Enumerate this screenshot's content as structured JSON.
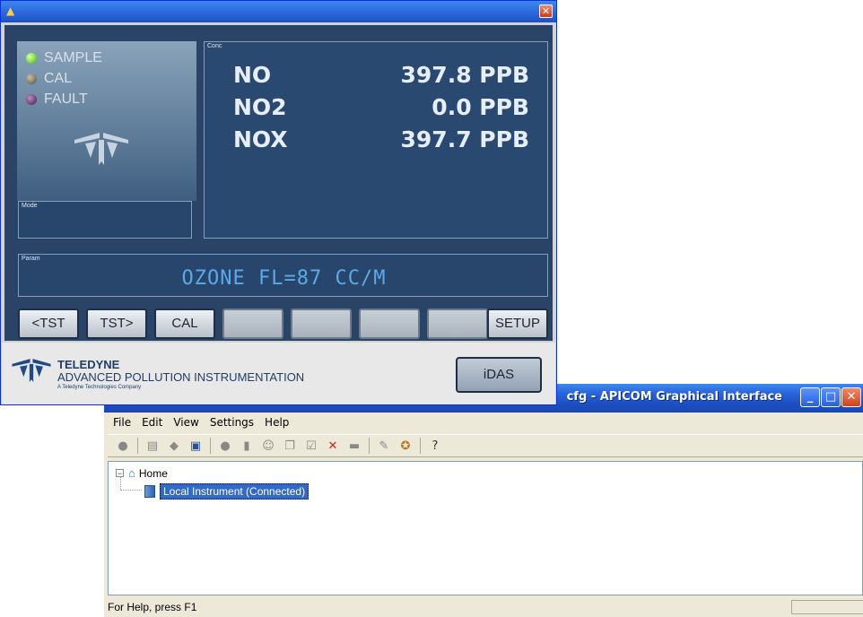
{
  "apicom": {
    "title": "cfg - APICOM Graphical Interface",
    "menu": [
      {
        "label": "File"
      },
      {
        "label": "Edit"
      },
      {
        "label": "View"
      },
      {
        "label": "Settings"
      },
      {
        "label": "Help"
      }
    ],
    "tree": {
      "root_label": "Home",
      "child_label": "Local Instrument (Connected)"
    },
    "status_text": "For Help, press F1"
  },
  "front": {
    "leds": [
      {
        "label": "SAMPLE",
        "color": "#7fe04a"
      },
      {
        "label": "CAL",
        "color": "#8a8270"
      },
      {
        "label": "FAULT",
        "color": "#7a4a7a"
      }
    ],
    "mode_label": "Mode",
    "conc_label": "Conc",
    "concentrations": [
      {
        "name": "NO",
        "value": "397.8 PPB"
      },
      {
        "name": "NO2",
        "value": "0.0 PPB"
      },
      {
        "name": "NOX",
        "value": "397.7 PPB"
      }
    ],
    "param_label": "Param",
    "param_text": "OZONE FL=87 CC/M",
    "buttons": [
      {
        "label": "<TST"
      },
      {
        "label": "TST>"
      },
      {
        "label": "CAL"
      },
      {
        "label": ""
      },
      {
        "label": ""
      },
      {
        "label": ""
      },
      {
        "label": ""
      },
      {
        "label": "SETUP"
      }
    ],
    "footer": {
      "brand": "TELEDYNE",
      "subtitle": "ADVANCED POLLUTION INSTRUMENTATION",
      "tagline": "A Teledyne Technologies Company",
      "idas_label": "iDAS"
    }
  }
}
